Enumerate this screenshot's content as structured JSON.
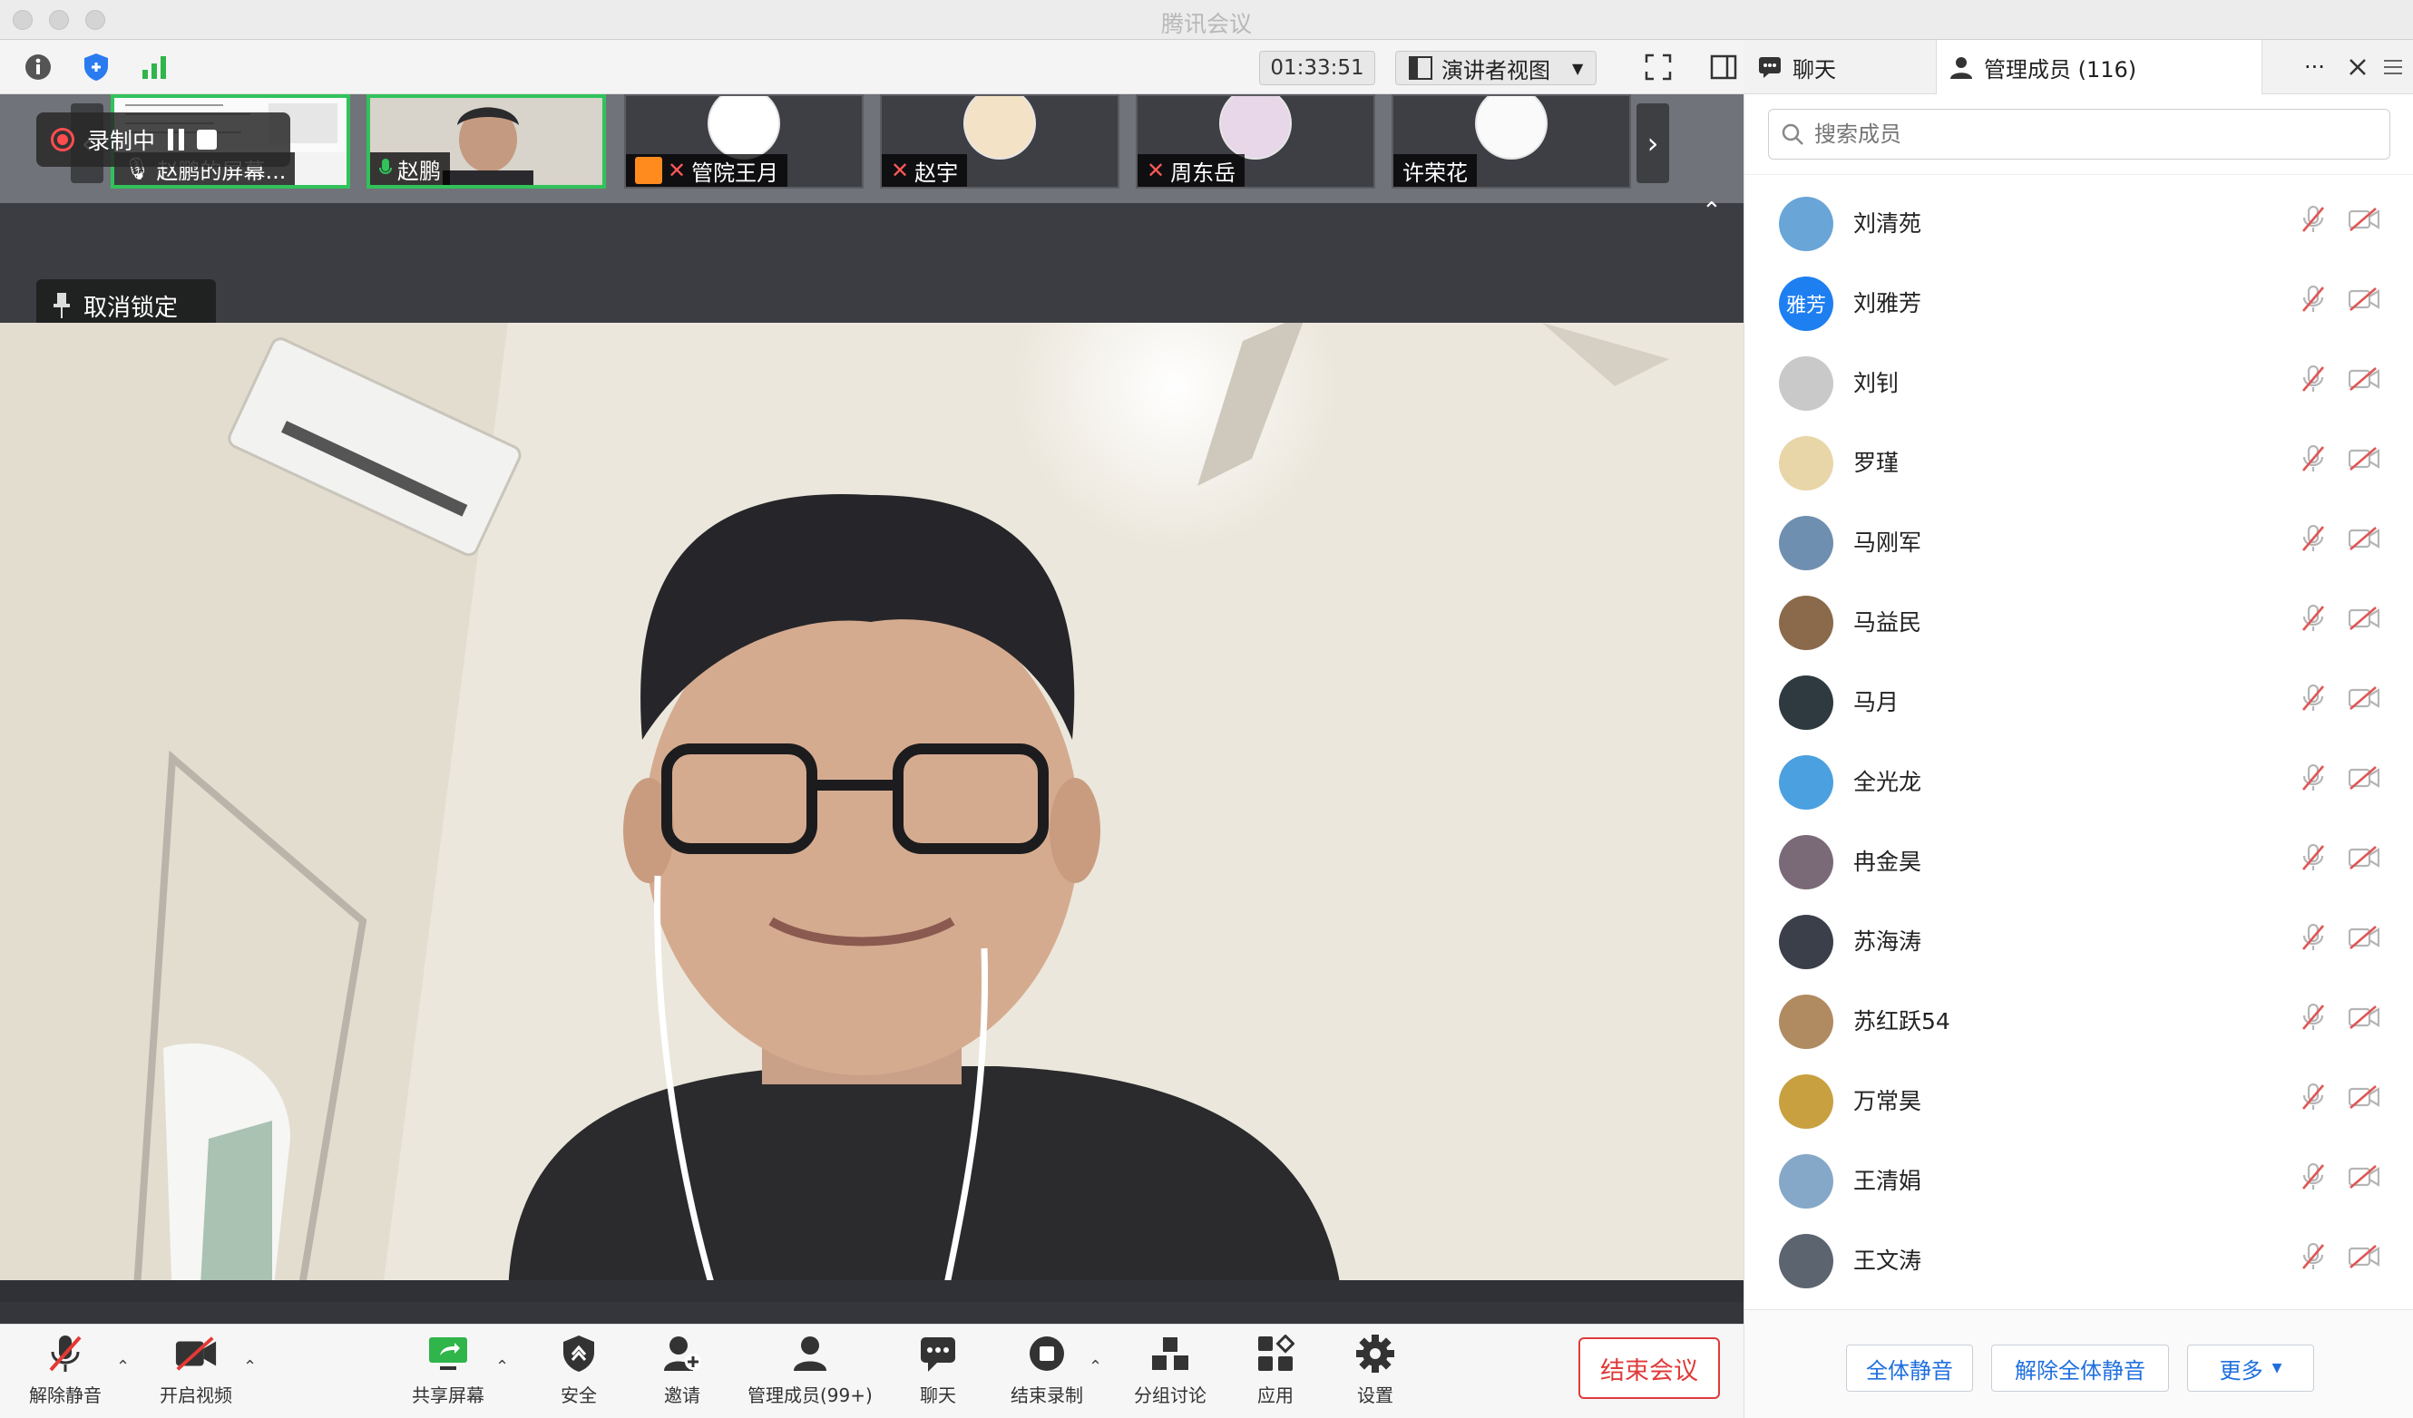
{
  "app": {
    "title": "腾讯会议"
  },
  "toolbar": {
    "timer": "01:33:51",
    "view_mode": "演讲者视图"
  },
  "panel_tabs": {
    "chat": "聊天",
    "members": "管理成员 (116)",
    "more": "···"
  },
  "recording": {
    "status": "录制中"
  },
  "stage": {
    "unpin_label": "取消锁定",
    "thumbnails": [
      {
        "name": "赵鹏的屏幕..."
      },
      {
        "name": "赵鹏"
      },
      {
        "name": "管院王月"
      },
      {
        "name": "赵宇"
      },
      {
        "name": "周东岳"
      },
      {
        "name": "许荣花"
      }
    ]
  },
  "controls": {
    "unmute": "解除静音",
    "start_video": "开启视频",
    "share_screen": "共享屏幕",
    "security": "安全",
    "invite": "邀请",
    "manage_members": "管理成员(99+)",
    "chat": "聊天",
    "end_record": "结束录制",
    "breakout": "分组讨论",
    "apps": "应用",
    "settings": "设置",
    "end_meeting": "结束会议"
  },
  "members": {
    "search_placeholder": "搜索成员",
    "list": [
      {
        "name": "刘清苑",
        "avatar_color": "#6aa5d8"
      },
      {
        "name": "刘雅芳",
        "avatar_text": "雅芳",
        "avatar_color": "#1e7ff0"
      },
      {
        "name": "刘钊",
        "avatar_color": "#c9c9c9"
      },
      {
        "name": "罗瑾",
        "avatar_color": "#e8d6a8"
      },
      {
        "name": "马刚军",
        "avatar_color": "#6f8fb0"
      },
      {
        "name": "马益民",
        "avatar_color": "#8a6a4a"
      },
      {
        "name": "马月",
        "avatar_color": "#2f3a40"
      },
      {
        "name": "全光龙",
        "avatar_color": "#4ba0e0"
      },
      {
        "name": "冉金昊",
        "avatar_color": "#7a6a78"
      },
      {
        "name": "苏海涛",
        "avatar_color": "#3a3f4a"
      },
      {
        "name": "苏红跃54",
        "avatar_color": "#b08a60"
      },
      {
        "name": "万常昊",
        "avatar_color": "#c9a040"
      },
      {
        "name": "王清娟",
        "avatar_color": "#86a8c8"
      },
      {
        "name": "王文涛",
        "avatar_color": "#5c6470"
      }
    ],
    "mute_all": "全体静音",
    "unmute_all": "解除全体静音",
    "more": "更多"
  }
}
